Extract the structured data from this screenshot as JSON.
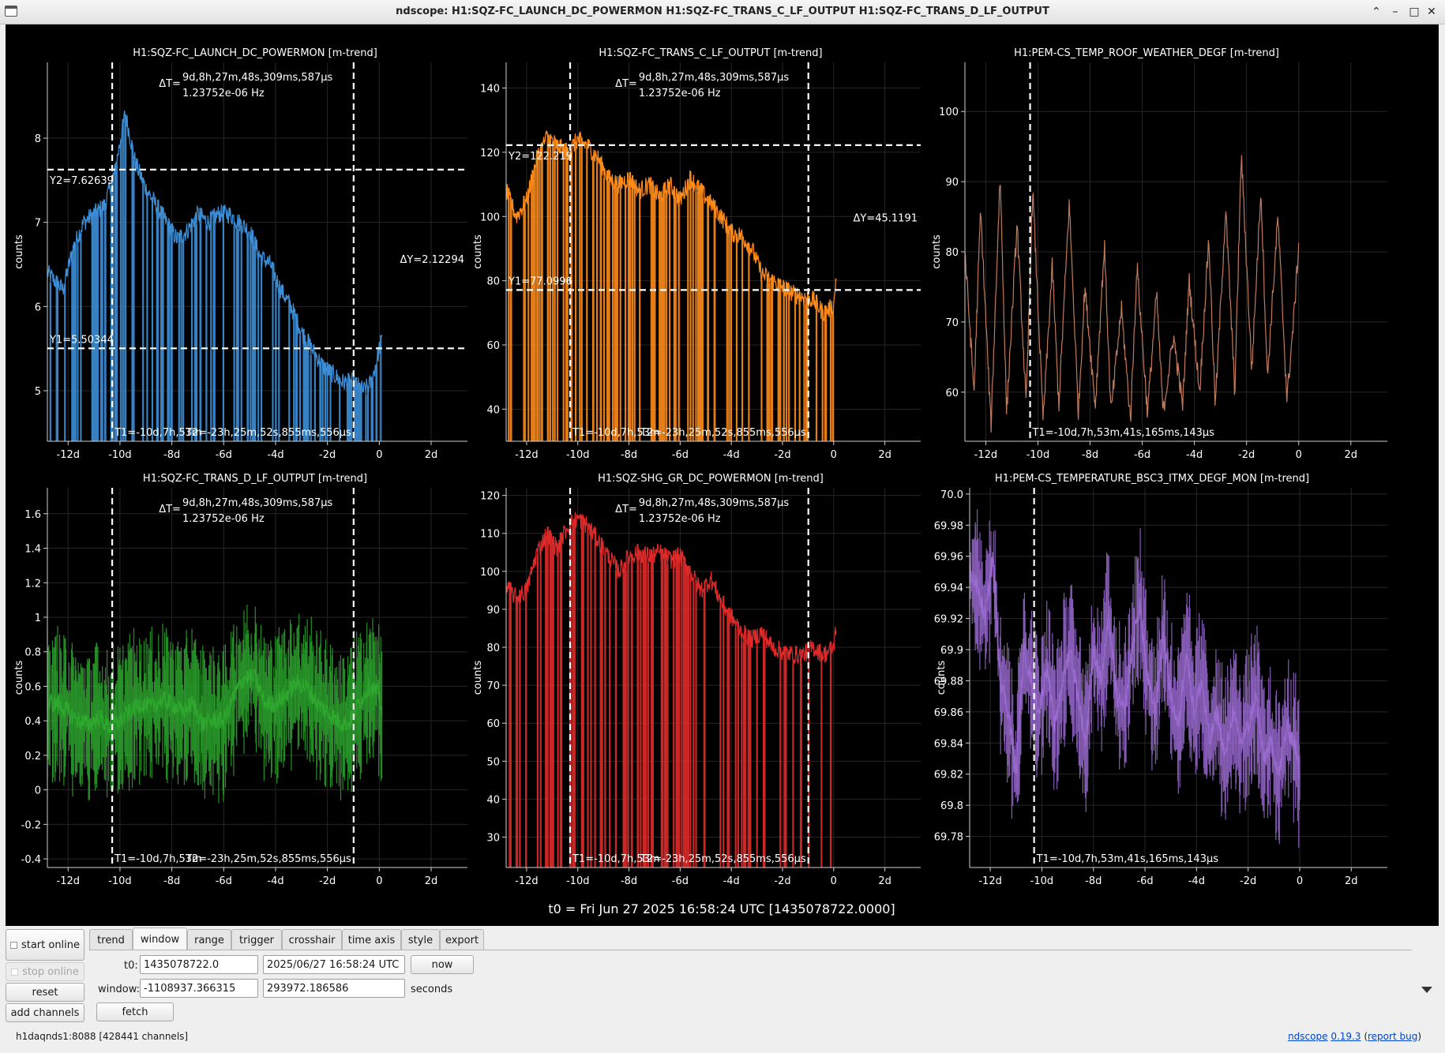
{
  "window": {
    "title": "ndscope: H1:SQZ-FC_LAUNCH_DC_POWERMON H1:SQZ-FC_TRANS_C_LF_OUTPUT H1:SQZ-FC_TRANS_D_LF_OUTPUT",
    "controls": {
      "minimize": "–",
      "maximize": "□",
      "close": "✕",
      "shade": "⌃"
    }
  },
  "t0_label": "t0 = Fri Jun 27 2025 16:58:24 UTC [1435078722.0000]",
  "chart_data": [
    {
      "type": "line",
      "title": "H1:SQZ-FC_LAUNCH_DC_POWERMON [m-trend]",
      "ylabel": "counts",
      "color": "#3d8ed6",
      "xlim": [
        -12.8,
        3.4
      ],
      "ylim": [
        4.4,
        8.9
      ],
      "xticks": [
        -12,
        -10,
        -8,
        -6,
        -4,
        -2,
        0,
        2
      ],
      "xtick_labels": [
        "-12d",
        "-10d",
        "-8d",
        "-6d",
        "-4d",
        "-2d",
        "0",
        "2d"
      ],
      "yticks": [
        5,
        6,
        7,
        8
      ],
      "ytick_labels": [
        "5",
        "6",
        "7",
        "8"
      ],
      "bars": true,
      "x": [
        -12.8,
        -12.5,
        -12.2,
        -11.8,
        -11.4,
        -11.0,
        -10.6,
        -10.2,
        -9.8,
        -9.4,
        -9.0,
        -8.6,
        -8.2,
        -7.8,
        -7.4,
        -7.0,
        -6.6,
        -6.2,
        -5.8,
        -5.4,
        -5.0,
        -4.6,
        -4.2,
        -3.8,
        -3.4,
        -3.0,
        -2.6,
        -2.2,
        -1.8,
        -1.4,
        -1.0,
        -0.6,
        -0.3,
        0.0,
        0.1
      ],
      "y": [
        6.4,
        6.3,
        6.2,
        6.7,
        7.0,
        7.1,
        7.2,
        7.6,
        8.3,
        7.7,
        7.4,
        7.2,
        7.0,
        6.8,
        6.9,
        7.1,
        7.0,
        7.1,
        7.1,
        7.0,
        6.9,
        6.6,
        6.5,
        6.2,
        6.0,
        5.7,
        5.5,
        5.3,
        5.2,
        5.1,
        5.1,
        5.0,
        5.1,
        5.5,
        5.6
      ],
      "cursors": {
        "t1": -10.3,
        "t2": -0.99,
        "y1": 5.50344,
        "y2": 7.62639,
        "t1_label": "T1=-10d,7h,53m",
        "t2_label": "T2=-23h,25m,52s,855ms,556µs",
        "y1_label": "Y1=5.50344",
        "y2_label": "Y2=7.62639",
        "dy_label": "ΔY=2.12294",
        "dt_label": "ΔT=",
        "dt_value": "9d,8h,27m,48s,309ms,587µs",
        "freq_label": "1.23752e-06 Hz"
      }
    },
    {
      "type": "line",
      "title": "H1:SQZ-FC_TRANS_C_LF_OUTPUT [m-trend]",
      "ylabel": "counts",
      "color": "#ff8c1a",
      "xlim": [
        -12.8,
        3.4
      ],
      "ylim": [
        30,
        148
      ],
      "xticks": [
        -12,
        -10,
        -8,
        -6,
        -4,
        -2,
        0,
        2
      ],
      "xtick_labels": [
        "-12d",
        "-10d",
        "-8d",
        "-6d",
        "-4d",
        "-2d",
        "0",
        "2d"
      ],
      "yticks": [
        40,
        60,
        80,
        100,
        120,
        140
      ],
      "ytick_labels": [
        "40",
        "60",
        "80",
        "100",
        "120",
        "140"
      ],
      "bars": true,
      "x": [
        -12.8,
        -12.4,
        -12.0,
        -11.6,
        -11.2,
        -10.8,
        -10.4,
        -10.0,
        -9.6,
        -9.2,
        -8.8,
        -8.4,
        -8.0,
        -7.6,
        -7.2,
        -6.8,
        -6.4,
        -6.0,
        -5.6,
        -5.2,
        -4.8,
        -4.4,
        -4.0,
        -3.6,
        -3.2,
        -2.8,
        -2.4,
        -2.0,
        -1.6,
        -1.2,
        -0.8,
        -0.4,
        0.0,
        0.1
      ],
      "y": [
        108,
        100,
        105,
        118,
        125,
        122,
        120,
        124,
        122,
        118,
        112,
        110,
        112,
        108,
        110,
        106,
        110,
        105,
        112,
        108,
        104,
        100,
        95,
        94,
        90,
        82,
        80,
        78,
        76,
        75,
        74,
        70,
        72,
        82
      ],
      "cursors": {
        "t1": -10.3,
        "t2": -0.99,
        "y1": 77.0996,
        "y2": 122.219,
        "t1_label": "T1=-10d,7h,53m",
        "t2_label": "T2=-23h,25m,52s,855ms,556µs",
        "y1_label": "Y1=77.0996",
        "y2_label": "Y2=122.219",
        "dy_label": "ΔY=45.1191",
        "dt_label": "ΔT=",
        "dt_value": "9d,8h,27m,48s,309ms,587µs",
        "freq_label": "1.23752e-06 Hz"
      }
    },
    {
      "type": "line",
      "title": "H1:PEM-CS_TEMP_ROOF_WEATHER_DEGF [m-trend]",
      "ylabel": "counts",
      "color": "#c07a5c",
      "xlim": [
        -12.8,
        3.4
      ],
      "ylim": [
        53,
        107
      ],
      "xticks": [
        -12,
        -10,
        -8,
        -6,
        -4,
        -2,
        0,
        2
      ],
      "xtick_labels": [
        "-12d",
        "-10d",
        "-8d",
        "-6d",
        "-4d",
        "-2d",
        "0",
        "2d"
      ],
      "yticks": [
        60,
        70,
        80,
        90,
        100
      ],
      "ytick_labels": [
        "60",
        "70",
        "80",
        "90",
        "100"
      ],
      "bars": false,
      "x": [
        -12.8,
        -12.45,
        -12.2,
        -11.8,
        -11.45,
        -11.2,
        -10.8,
        -10.45,
        -10.2,
        -9.8,
        -9.45,
        -9.2,
        -8.8,
        -8.45,
        -8.2,
        -7.8,
        -7.45,
        -7.2,
        -6.8,
        -6.45,
        -6.2,
        -5.8,
        -5.45,
        -5.2,
        -4.8,
        -4.45,
        -4.2,
        -3.8,
        -3.45,
        -3.2,
        -2.8,
        -2.45,
        -2.2,
        -1.8,
        -1.45,
        -1.2,
        -0.8,
        -0.45,
        -0.2,
        0.0
      ],
      "y": [
        80,
        60,
        86,
        55,
        91,
        57,
        84,
        58,
        89,
        56,
        78,
        58,
        87,
        57,
        75,
        58,
        81,
        57,
        72,
        56,
        78,
        57,
        74,
        57,
        68,
        58,
        76,
        60,
        82,
        58,
        86,
        60,
        94,
        63,
        89,
        62,
        85,
        59,
        70,
        81
      ],
      "cursors": {
        "t1": -10.3,
        "t1_label": "T1=-10d,7h,53m,41s,165ms,143µs"
      }
    },
    {
      "type": "line",
      "title": "H1:SQZ-FC_TRANS_D_LF_OUTPUT [m-trend]",
      "ylabel": "counts",
      "color": "#2ea82e",
      "xlim": [
        -12.8,
        3.4
      ],
      "ylim": [
        -0.45,
        1.75
      ],
      "xticks": [
        -12,
        -10,
        -8,
        -6,
        -4,
        -2,
        0,
        2
      ],
      "xtick_labels": [
        "-12d",
        "-10d",
        "-8d",
        "-6d",
        "-4d",
        "-2d",
        "0",
        "2d"
      ],
      "yticks": [
        -0.4,
        -0.2,
        0,
        0.2,
        0.4,
        0.6,
        0.8,
        1,
        1.2,
        1.4,
        1.6
      ],
      "ytick_labels": [
        "-0.4",
        "-0.2",
        "0",
        "0.2",
        "0.4",
        "0.6",
        "0.8",
        "1",
        "1.2",
        "1.4",
        "1.6"
      ],
      "bars": false,
      "x": [
        -12.8,
        -12.4,
        -12.0,
        -11.6,
        -11.2,
        -10.8,
        -10.4,
        -10.0,
        -9.6,
        -9.2,
        -8.8,
        -8.4,
        -8.0,
        -7.6,
        -7.2,
        -6.8,
        -6.4,
        -6.0,
        -5.6,
        -5.2,
        -4.8,
        -4.4,
        -4.0,
        -3.6,
        -3.2,
        -2.8,
        -2.4,
        -2.0,
        -1.6,
        -1.2,
        -0.8,
        -0.4,
        0.0,
        0.1
      ],
      "y": [
        0.5,
        0.5,
        0.45,
        0.4,
        0.38,
        0.42,
        0.36,
        0.4,
        0.45,
        0.5,
        0.48,
        0.52,
        0.5,
        0.45,
        0.5,
        0.38,
        0.4,
        0.4,
        0.55,
        0.65,
        0.65,
        0.5,
        0.5,
        0.55,
        0.62,
        0.6,
        0.5,
        0.45,
        0.4,
        0.38,
        0.5,
        0.6,
        0.55,
        0.45
      ],
      "cursors": {
        "t1": -10.3,
        "t2": -0.99,
        "t1_label": "T1=-10d,7h,53m",
        "t2_label": "T2=-23h,25m,52s,855ms,556µs",
        "dt_label": "ΔT=",
        "dt_value": "9d,8h,27m,48s,309ms,587µs",
        "freq_label": "1.23752e-06 Hz"
      }
    },
    {
      "type": "line",
      "title": "H1:SQZ-SHG_GR_DC_POWERMON [m-trend]",
      "ylabel": "counts",
      "color": "#e02a2a",
      "xlim": [
        -12.8,
        3.4
      ],
      "ylim": [
        22,
        122
      ],
      "xticks": [
        -12,
        -10,
        -8,
        -6,
        -4,
        -2,
        0,
        2
      ],
      "xtick_labels": [
        "-12d",
        "-10d",
        "-8d",
        "-6d",
        "-4d",
        "-2d",
        "0",
        "2d"
      ],
      "yticks": [
        30,
        40,
        50,
        60,
        70,
        80,
        90,
        100,
        110,
        120
      ],
      "ytick_labels": [
        "30",
        "40",
        "50",
        "60",
        "70",
        "80",
        "90",
        "100",
        "110",
        "120"
      ],
      "bars": true,
      "x": [
        -12.8,
        -12.4,
        -12.0,
        -11.6,
        -11.2,
        -10.8,
        -10.4,
        -10.0,
        -9.6,
        -9.2,
        -8.8,
        -8.4,
        -8.0,
        -7.6,
        -7.2,
        -6.8,
        -6.4,
        -6.0,
        -5.6,
        -5.2,
        -4.8,
        -4.4,
        -4.0,
        -3.6,
        -3.2,
        -2.8,
        -2.4,
        -2.0,
        -1.6,
        -1.2,
        -0.8,
        -0.4,
        0.0,
        0.1
      ],
      "y": [
        96,
        93,
        95,
        105,
        110,
        106,
        112,
        114,
        112,
        108,
        104,
        100,
        104,
        105,
        104,
        105,
        103,
        104,
        100,
        95,
        98,
        92,
        88,
        84,
        82,
        84,
        80,
        79,
        78,
        78,
        80,
        78,
        80,
        86
      ],
      "cursors": {
        "t1": -10.3,
        "t2": -0.99,
        "t1_label": "T1=-10d,7h,53m",
        "t2_label": "T2=-23h,25m,52s,855ms,556µs",
        "dt_label": "ΔT=",
        "dt_value": "9d,8h,27m,48s,309ms,587µs",
        "freq_label": "1.23752e-06 Hz"
      }
    },
    {
      "type": "line",
      "title": "H1:PEM-CS_TEMPERATURE_BSC3_ITMX_DEGF_MON [m-trend]",
      "ylabel": "counts",
      "color": "#9b6bd1",
      "xlim": [
        -12.8,
        3.4
      ],
      "ylim": [
        69.76,
        70.004
      ],
      "xticks": [
        -12,
        -10,
        -8,
        -6,
        -4,
        -2,
        0,
        2
      ],
      "xtick_labels": [
        "-12d",
        "-10d",
        "-8d",
        "-6d",
        "-4d",
        "-2d",
        "0",
        "2d"
      ],
      "yticks": [
        69.78,
        69.8,
        69.82,
        69.84,
        69.86,
        69.88,
        69.9,
        69.92,
        69.94,
        69.96,
        69.98,
        70.0
      ],
      "ytick_labels": [
        "69.78",
        "69.8",
        "69.82",
        "69.84",
        "69.86",
        "69.88",
        "69.9",
        "69.92",
        "69.94",
        "69.96",
        "69.98",
        "70.0"
      ],
      "bars": false,
      "x": [
        -12.8,
        -12.5,
        -12.2,
        -11.9,
        -11.6,
        -11.3,
        -11.0,
        -10.7,
        -10.4,
        -10.1,
        -9.8,
        -9.5,
        -9.2,
        -8.9,
        -8.6,
        -8.3,
        -8.0,
        -7.7,
        -7.4,
        -7.1,
        -6.8,
        -6.5,
        -6.2,
        -5.9,
        -5.6,
        -5.3,
        -5.0,
        -4.7,
        -4.4,
        -4.1,
        -3.8,
        -3.5,
        -3.2,
        -2.9,
        -2.6,
        -2.3,
        -2.0,
        -1.7,
        -1.4,
        -1.1,
        -0.8,
        -0.5,
        -0.2,
        0.0
      ],
      "y": [
        69.95,
        69.94,
        69.92,
        69.96,
        69.88,
        69.86,
        69.82,
        69.9,
        69.88,
        69.86,
        69.89,
        69.85,
        69.88,
        69.9,
        69.87,
        69.84,
        69.9,
        69.88,
        69.92,
        69.87,
        69.86,
        69.9,
        69.93,
        69.88,
        69.86,
        69.91,
        69.87,
        69.85,
        69.9,
        69.86,
        69.88,
        69.84,
        69.86,
        69.83,
        69.86,
        69.84,
        69.85,
        69.87,
        69.83,
        69.84,
        69.82,
        69.85,
        69.84,
        69.82
      ],
      "cursors": {
        "t1": -10.3,
        "t1_label": "T1=-10d,7h,53m,41s,165ms,143µs"
      }
    }
  ],
  "controls": {
    "start_online": "start online",
    "stop_online": "stop online",
    "reset": "reset",
    "add_channels": "add channels",
    "tabs": [
      "trend",
      "window",
      "range",
      "trigger",
      "crosshair",
      "time axis",
      "style",
      "export"
    ],
    "active_tab": "window",
    "t0_label": "t0:",
    "t0_gps": "1435078722.0",
    "t0_utc": "2025/06/27 16:58:24 UTC",
    "now": "now",
    "window_label": "window:",
    "window_start": "-1108937.366315",
    "window_end": "293972.186586",
    "window_units": "seconds",
    "fetch": "fetch"
  },
  "status": {
    "server": "h1daqnds1:8088",
    "channels": "[428441 channels]",
    "app_name": "ndscope",
    "version": "0.19.3",
    "report_bug": "report bug"
  },
  "style": {
    "plot_bg": "#000000",
    "grid": "#262626",
    "axis": "#cfcfcf",
    "text": "#ffffff",
    "cursor": "#ffffff"
  }
}
